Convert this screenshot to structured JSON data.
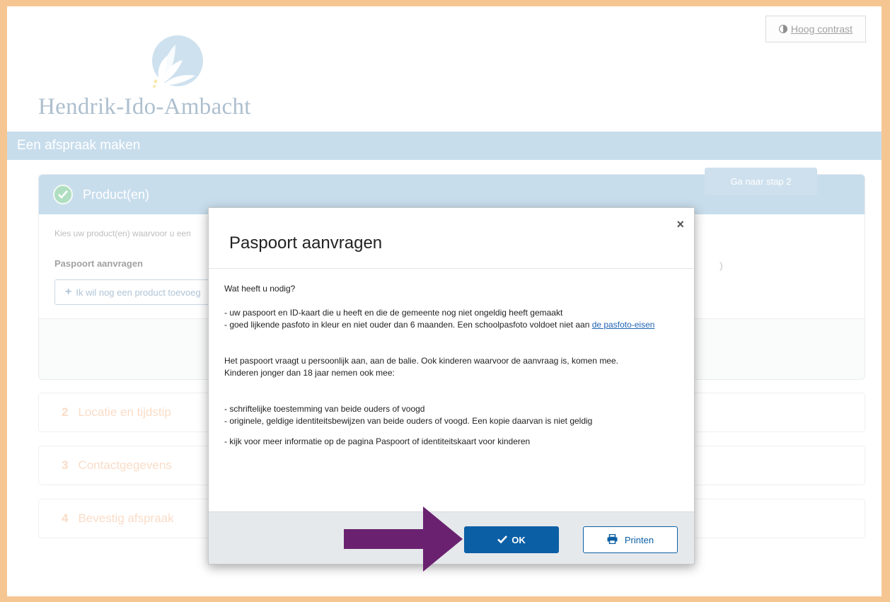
{
  "header": {
    "contrast_label": "Hoog contrast",
    "logo_text": "Hendrik-Ido-Ambacht",
    "page_title": "Een afspraak maken"
  },
  "step1": {
    "title": "Product(en)",
    "intro": "Kies uw product(en) waarvoor u een",
    "product_name": "Paspoort aanvragen",
    "add_label": "Ik wil nog een product toevoeg",
    "right_cut": ")",
    "next_label": "Ga naar stap 2"
  },
  "steps": [
    {
      "num": "2",
      "label": "Locatie en tijdstip"
    },
    {
      "num": "3",
      "label": "Contactgegevens"
    },
    {
      "num": "4",
      "label": "Bevestig afspraak"
    }
  ],
  "modal": {
    "title": "Paspoort aanvragen",
    "close": "×",
    "question": "Wat heeft u nodig?",
    "need_1": "- uw paspoort en ID-kaart die u heeft en die de gemeente nog niet ongeldig heeft gemaakt",
    "need_2_text": "- goed lijkende pasfoto in kleur en niet ouder dan 6 maanden. Een schoolpasfoto voldoet niet aan ",
    "need_2_link": "de pasfoto-eisen",
    "para_1": "Het paspoort vraagt u persoonlijk aan, aan de balie. Ook kinderen waarvoor de aanvraag is, komen mee.",
    "para_2": "Kinderen jonger dan 18 jaar nemen ook mee:",
    "kid_1": "- schriftelijke toestemming van beide ouders of voogd",
    "kid_2": "- originele, geldige identiteitsbewijzen van beide ouders of voogd. Een kopie daarvan is niet geldig",
    "more_info": "- kijk voor meer informatie op de pagina Paspoort of identiteitskaart voor kinderen",
    "ok_label": "OK",
    "print_label": "Printen"
  },
  "colors": {
    "accent": "#9cc2dc",
    "primary_button": "#0b5fa5",
    "step_text": "#f6c09a",
    "arrow": "#6a2270",
    "border": "#f6c692"
  }
}
